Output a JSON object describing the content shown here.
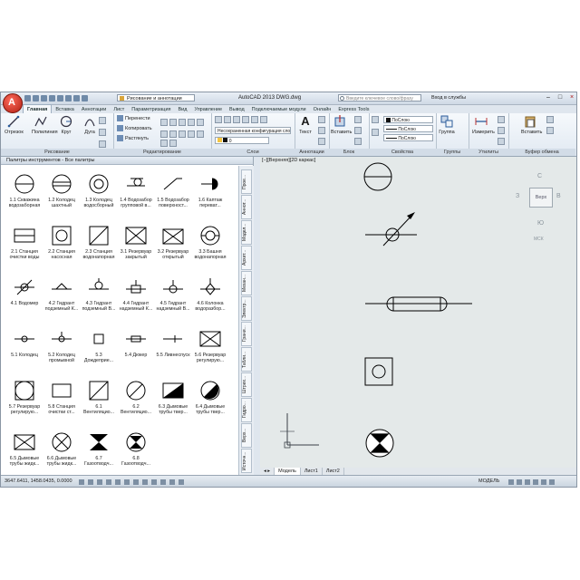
{
  "titlebar": {
    "workspace": "Рисование и аннотации",
    "title": "AutoCAD 2013    DWG.dwg",
    "search_placeholder": "Введите ключевое слово/фразу",
    "signin": "Вход в службы"
  },
  "tabs": [
    "Главная",
    "Вставка",
    "Аннотации",
    "Лист",
    "Параметризация",
    "Вид",
    "Управление",
    "Вывод",
    "Подключаемые модули",
    "Онлайн",
    "Express Tools"
  ],
  "ribbon": {
    "draw": {
      "label": "Рисование",
      "line": "Отрезок",
      "polyline": "Полилиния",
      "circle": "Круг",
      "arc": "Дуга"
    },
    "modify": {
      "label": "Редактирование",
      "move": "Перенести",
      "copy": "Копировать",
      "stretch": "Растянуть"
    },
    "layers": {
      "label": "Слои",
      "layer_state": "Несохраненная конфигурация сло"
    },
    "annotation": {
      "label": "Аннотации",
      "text": "Текст"
    },
    "block": {
      "label": "Блок",
      "insert": "Вставить"
    },
    "properties": {
      "label": "Свойства",
      "bylayer1": "ПоСлою",
      "bylayer2": "ПоСлою",
      "bylayer3": "ПоСлою"
    },
    "groups": {
      "label": "Группы",
      "group": "Группа"
    },
    "utilities": {
      "label": "Утилиты",
      "measure": "Измерить"
    },
    "clipboard": {
      "label": "Буфер обмена",
      "paste": "Вставить"
    }
  },
  "palette": {
    "title": "Палитры инструментов - Все палитры",
    "items": [
      "1.1 Скважина водозаборная",
      "1.2 Колодец шахтный",
      "1.3 Колодец водосборный",
      "1.4 Водозабор групповой в...",
      "1.5 Водозабор поверхност...",
      "1.6 Каптаж переват...",
      "2.1 Станция очистки воды",
      "2.2 Станция насосная",
      "2.3 Станция водонапорная",
      "3.1 Резервуар закрытый",
      "3.2 Резервуар открытый",
      "3.3 Башня водонапорная",
      "4.1 Водомер",
      "4.2 Гидрант подземный К...",
      "4.3 Гидрант подземный В...",
      "4.4 Гидрант надземный К...",
      "4.5 Гидрант надземный В...",
      "4.6 Колонка водоразбор...",
      "5.1 Колодец",
      "5.2 Колодец промывной",
      "5.3 Дождеприе...",
      "5.4 Дюкер",
      "5.5 Ливнеспуск",
      "5.6 Резервуар регулирую...",
      "5.7 Резервуар регулирую...",
      "5.8 Станция очистки ст...",
      "6.1 Вентиляцио...",
      "6.2 Вентиляцио...",
      "6.3 Дымовые трубы твер...",
      "6.4 Дымовые трубы твер...",
      "6.5 Дымовые трубы жидк...",
      "6.6 Дымовые трубы жидк...",
      "6.7 Газоотводч...",
      "6.8 Газоотводч..."
    ],
    "side_tabs": [
      "Прое...",
      "Аннот...",
      "Модел...",
      "Архит...",
      "Механ...",
      "Электр...",
      "Грани...",
      "Табли...",
      "Штрих...",
      "Гидро...",
      "Верх...",
      "Источн..."
    ]
  },
  "viewport": {
    "label": "[−][Верхняя][2D каркас]",
    "viewcube": "Верх",
    "wcs": "МСК",
    "compass": {
      "n": "С",
      "w": "З",
      "e": "В",
      "s": "Ю"
    }
  },
  "layout_tabs": [
    "Модель",
    "Лист1",
    "Лист2"
  ],
  "status": {
    "coords": "3647.6411, 1458.0435, 0.0000",
    "model": "МОДЕЛЬ"
  },
  "colors": {
    "accent": "#2a5b9a",
    "app_button": "#d33a2a",
    "viewport_bg": "#e4e9e9"
  }
}
